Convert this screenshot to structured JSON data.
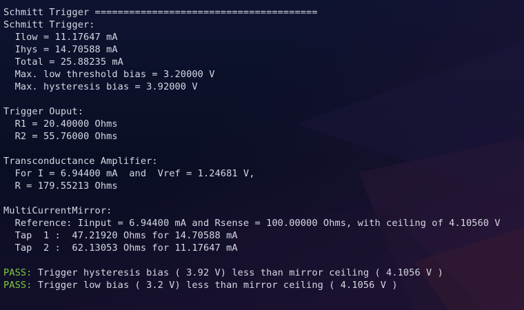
{
  "terminal": {
    "lines": [
      {
        "text": "Schmitt Trigger ======================================="
      },
      {
        "text": "Schmitt Trigger:"
      },
      {
        "text": "  Ilow = 11.17647 mA"
      },
      {
        "text": "  Ihys = 14.70588 mA"
      },
      {
        "text": "  Total = 25.88235 mA"
      },
      {
        "text": "  Max. low threshold bias = 3.20000 V"
      },
      {
        "text": "  Max. hysteresis bias = 3.92000 V"
      },
      {
        "text": ""
      },
      {
        "text": "Trigger Ouput:"
      },
      {
        "text": "  R1 = 20.40000 Ohms"
      },
      {
        "text": "  R2 = 55.76000 Ohms"
      },
      {
        "text": ""
      },
      {
        "text": "Transconductance Amplifier:"
      },
      {
        "text": "  For I = 6.94400 mA  and  Vref = 1.24681 V,"
      },
      {
        "text": "  R = 179.55213 Ohms"
      },
      {
        "text": ""
      },
      {
        "text": "MultiCurrentMirror:"
      },
      {
        "text": "  Reference: Iinput = 6.94400 mA and Rsense = 100.00000 Ohms, with ceiling of 4.10560 V"
      },
      {
        "text": "  Tap  1 :  47.21920 Ohms for 14.70588 mA"
      },
      {
        "text": "  Tap  2 :  62.13053 Ohms for 11.17647 mA"
      },
      {
        "text": ""
      },
      {
        "prefix": "PASS:",
        "text": " Trigger hysteresis bias ( 3.92 V) less than mirror ceiling ( 4.1056 V )"
      },
      {
        "prefix": "PASS:",
        "text": " Trigger low bias ( 3.2 V) less than mirror ceiling ( 4.1056 V )"
      }
    ]
  },
  "colors": {
    "text": "#d6d8e4",
    "pass": "#7ecb3a",
    "background": "#0c1024"
  }
}
